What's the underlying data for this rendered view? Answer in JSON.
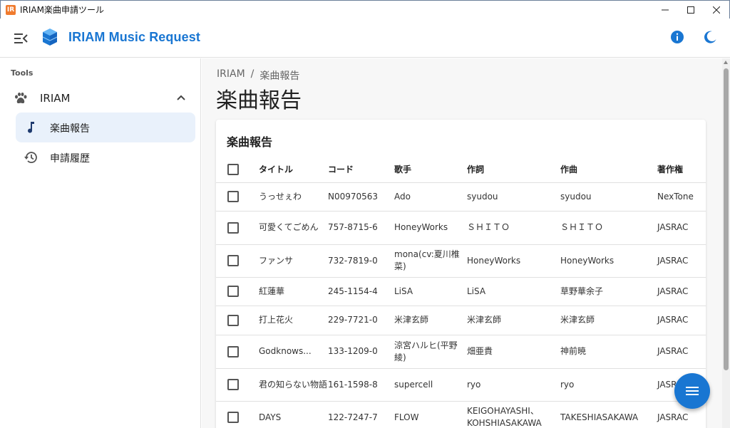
{
  "window": {
    "title": "IRIAM楽曲申請ツール",
    "icon_label": "IR",
    "controls": [
      "minimize",
      "maximize",
      "close"
    ]
  },
  "appbar": {
    "app_name": "IRIAM Music Request",
    "brand_color": "#1976d2"
  },
  "sidebar": {
    "section_label": "Tools",
    "group": {
      "label": "IRIAM",
      "icon": "paw-icon",
      "expanded": true
    },
    "items": [
      {
        "label": "楽曲報告",
        "icon": "music-note-icon",
        "active": true
      },
      {
        "label": "申請履歴",
        "icon": "history-icon",
        "active": false
      }
    ]
  },
  "main": {
    "breadcrumb": [
      "IRIAM",
      "楽曲報告"
    ],
    "breadcrumb_sep": "/",
    "page_title": "楽曲報告",
    "card_title": "楽曲報告",
    "columns": [
      "タイトル",
      "コード",
      "歌手",
      "作詞",
      "作曲",
      "著作権"
    ],
    "rows": [
      {
        "title": "うっせぇわ",
        "code": "N00970563",
        "artist": "Ado",
        "lyricist": "syudou",
        "composer": "syudou",
        "rights": "NexTone"
      },
      {
        "title": "可愛くてごめん",
        "code": "757-8715-6",
        "artist": "HoneyWorks",
        "lyricist": "ＳＨＩＴＯ",
        "composer": "ＳＨＩＴＯ",
        "rights": "JASRAC"
      },
      {
        "title": "ファンサ",
        "code": "732-7819-0",
        "artist": "mona(cv:夏川椎菜)",
        "lyricist": "HoneyWorks",
        "composer": "HoneyWorks",
        "rights": "JASRAC"
      },
      {
        "title": "紅蓮華",
        "code": "245-1154-4",
        "artist": "LiSA",
        "lyricist": "LiSA",
        "composer": "草野華余子",
        "rights": "JASRAC"
      },
      {
        "title": "打上花火",
        "code": "229-7721-0",
        "artist": "米津玄師",
        "lyricist": "米津玄師",
        "composer": "米津玄師",
        "rights": "JASRAC"
      },
      {
        "title": "Godknows...",
        "code": "133-1209-0",
        "artist": "涼宮ハルヒ(平野綾)",
        "lyricist": "畑亜貴",
        "composer": "神前暁",
        "rights": "JASRAC"
      },
      {
        "title": "君の知らない物語",
        "code": "161-1598-8",
        "artist": "supercell",
        "lyricist": "ryo",
        "composer": "ryo",
        "rights": "JASRAC"
      },
      {
        "title": "DAYS",
        "code": "122-7247-7",
        "artist": "FLOW",
        "lyricist": "KEIGOHAYASHI、KOHSHIASAKAWA",
        "composer": "TAKESHIASAKAWA",
        "rights": "JASRAC"
      }
    ]
  },
  "fab": {
    "icon": "menu-icon"
  }
}
